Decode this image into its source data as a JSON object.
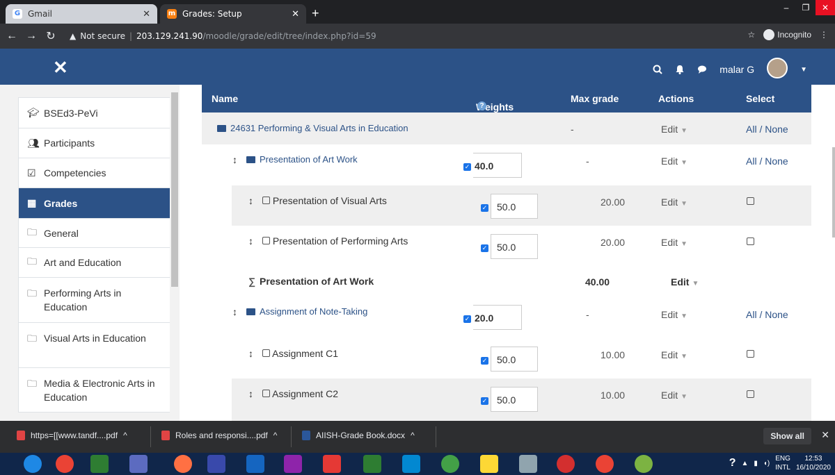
{
  "browser": {
    "tabs": [
      {
        "title": "Gmail",
        "active": false
      },
      {
        "title": "Grades: Setup",
        "active": true
      }
    ],
    "address": {
      "security": "Not secure",
      "host": "203.129.241.90",
      "path": "/moodle/grade/edit/tree/index.php?id=59"
    },
    "incognito_label": "Incognito"
  },
  "navbar": {
    "user_name": "malar G"
  },
  "drawer": {
    "items": [
      {
        "label": "BSEd3-PeVi",
        "icon": "graduation-cap-icon",
        "active": false
      },
      {
        "label": "Participants",
        "icon": "users-icon",
        "active": false
      },
      {
        "label": "Competencies",
        "icon": "check-square-icon",
        "active": false
      },
      {
        "label": "Grades",
        "icon": "table-icon",
        "active": true
      },
      {
        "label": "General",
        "icon": "folder-outline-icon",
        "active": false
      },
      {
        "label": "Art and Education",
        "icon": "folder-outline-icon",
        "active": false
      },
      {
        "label": "Performing Arts in Education",
        "icon": "folder-outline-icon",
        "active": false
      },
      {
        "label": "Visual Arts in Education",
        "icon": "folder-outline-icon",
        "active": false
      },
      {
        "label": "Media & Electronic Arts in Education",
        "icon": "folder-outline-icon",
        "active": false
      }
    ]
  },
  "table": {
    "headers": {
      "name": "Name",
      "weights": "Weights",
      "max_grade": "Max grade",
      "actions": "Actions",
      "select": "Select"
    },
    "rows": [
      {
        "kind": "course",
        "name": "24631 Performing & Visual Arts in Education",
        "weight": "",
        "max": "-",
        "action": "Edit",
        "select": "All / None"
      },
      {
        "kind": "category",
        "name": "Presentation of Art Work",
        "weight": "40.0",
        "max": "-",
        "action": "Edit",
        "select": "All / None"
      },
      {
        "kind": "item",
        "name": "Presentation of Visual Arts",
        "weight": "50.0",
        "max": "20.00",
        "action": "Edit",
        "select": ""
      },
      {
        "kind": "item",
        "name": "Presentation of Performing Arts",
        "weight": "50.0",
        "max": "20.00",
        "action": "Edit",
        "select": ""
      },
      {
        "kind": "total",
        "name": "Presentation of Art Work",
        "weight": "",
        "max": "40.00",
        "action": "Edit",
        "select": ""
      },
      {
        "kind": "category",
        "name": "Assignment of Note-Taking",
        "weight": "20.0",
        "max": "-",
        "action": "Edit",
        "select": "All / None"
      },
      {
        "kind": "item",
        "name": "Assignment C1",
        "weight": "50.0",
        "max": "10.00",
        "action": "Edit",
        "select": ""
      },
      {
        "kind": "item",
        "name": "Assignment C2",
        "weight": "50.0",
        "max": "10.00",
        "action": "Edit",
        "select": ""
      }
    ]
  },
  "downloads": {
    "items": [
      "https=[[www.tandf....pdf",
      "Roles and responsi....pdf",
      "AIISH-Grade Book.docx"
    ],
    "show_all": "Show all"
  },
  "taskbar": {
    "lang": "ENG",
    "region": "INTL",
    "time": "12:53",
    "date": "16/10/2020"
  },
  "colors": {
    "brand": "#2c5287",
    "row_alt": "#efefef"
  }
}
